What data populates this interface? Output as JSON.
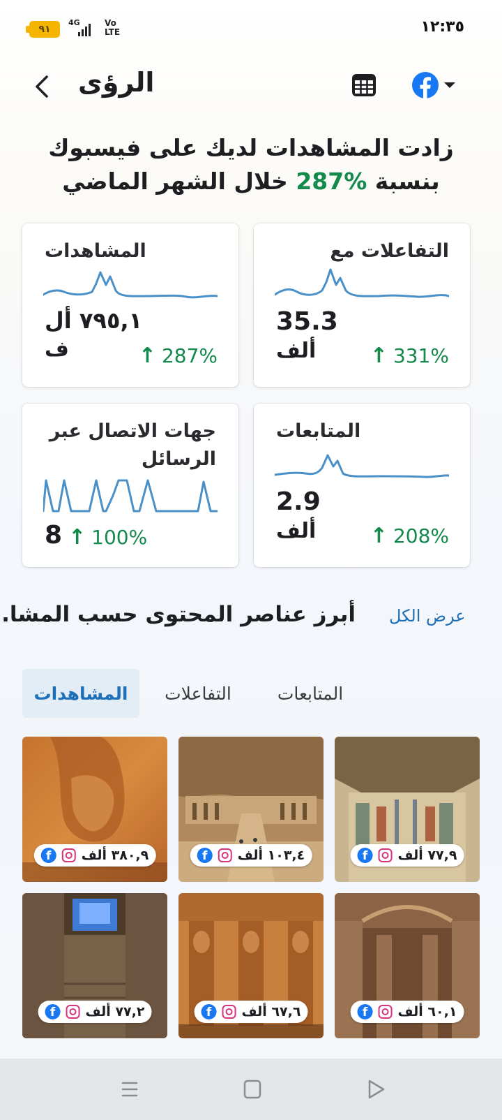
{
  "status_bar": {
    "battery": "٩١",
    "network": "4G",
    "volte_top": "Vo",
    "volte_bottom": "LTE",
    "time": "١٢:٣٥"
  },
  "header": {
    "title": "الرؤى"
  },
  "headline": {
    "text_before": "زادت المشاهدات لديك على فيسبوك بنسبة ",
    "percent": "287%",
    "text_after": " خلال الشهر الماضي"
  },
  "cards": {
    "views": {
      "title": "المشاهدات",
      "value": "٧٩٥,١ أل",
      "value_unit": "ف",
      "change": "287%"
    },
    "interactions": {
      "title": "التفاعلات مع",
      "value": "35.3",
      "value_unit": "ألف",
      "change": "331%"
    },
    "contacts": {
      "title_line1": "جهات الاتصال عبر",
      "title_line2": "الرسائل",
      "value": "8",
      "change": "100%"
    },
    "follows": {
      "title": "المتابعات",
      "value": "2.9",
      "value_unit": "ألف",
      "change": "208%"
    }
  },
  "top_content": {
    "title": "أبرز عناصر المحتوى حسب المشا...",
    "see_all": "عرض الكل",
    "tabs": [
      "المشاهدات",
      "التفاعلات",
      "المتابعات"
    ],
    "items": [
      {
        "value": "٣٨٠,٩ ألف"
      },
      {
        "value": "١٠٣,٤ ألف"
      },
      {
        "value": "٧٧,٩ ألف"
      },
      {
        "value": "٧٧,٢ ألف"
      },
      {
        "value": "٦٧,٦ ألف"
      },
      {
        "value": "٦٠,١ ألف"
      }
    ]
  },
  "colors": {
    "positive_green": "#138a4c",
    "link_blue": "#1d6fb8",
    "facebook_blue": "#1877f2",
    "spark_blue": "#4a90c8"
  },
  "icons": [
    "back-chevron-icon",
    "calendar-grid-icon",
    "facebook-icon",
    "dropdown-caret-icon",
    "up-arrow-icon",
    "instagram-icon",
    "menu-icon",
    "home-icon",
    "back-triangle-icon"
  ]
}
